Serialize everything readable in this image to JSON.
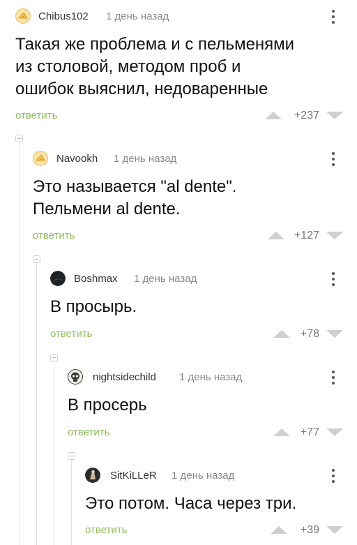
{
  "comments": [
    {
      "author": "Chibus102",
      "time": "1 день назад",
      "text_lines": [
        "Такая же проблема и с пельменями",
        "из столовой, методом проб и",
        "ошибок выяснил, недоваренные"
      ],
      "reply_label": "ответить",
      "rating": "+237",
      "avatar_icon": "cheese-avatar-icon"
    },
    {
      "author": "Navookh",
      "time": "1 день назад",
      "text_lines": [
        "Это называется \"al dente\".",
        "Пельмени al dente."
      ],
      "reply_label": "ответить",
      "rating": "+127",
      "avatar_icon": "cheese-avatar-icon"
    },
    {
      "author": "Boshmax",
      "time": "1 день назад",
      "text_lines": [
        "В просырь."
      ],
      "reply_label": "ответить",
      "rating": "+78",
      "avatar_icon": "dark-avatar-icon"
    },
    {
      "author": "nightsidechild",
      "time": "1 день назад",
      "text_lines": [
        "В просерь"
      ],
      "reply_label": "ответить",
      "rating": "+77",
      "avatar_icon": "skull-avatar-icon"
    },
    {
      "author": "SitKiLLeR",
      "time": "1 день назад",
      "text_lines": [
        "Это потом. Часа через три."
      ],
      "reply_label": "ответить",
      "rating": "+39",
      "avatar_icon": "figure-avatar-icon"
    }
  ],
  "colors": {
    "reply_green": "#8fbf59",
    "muted_gray": "#888888",
    "vote_arrow": "#cfcfcf"
  }
}
